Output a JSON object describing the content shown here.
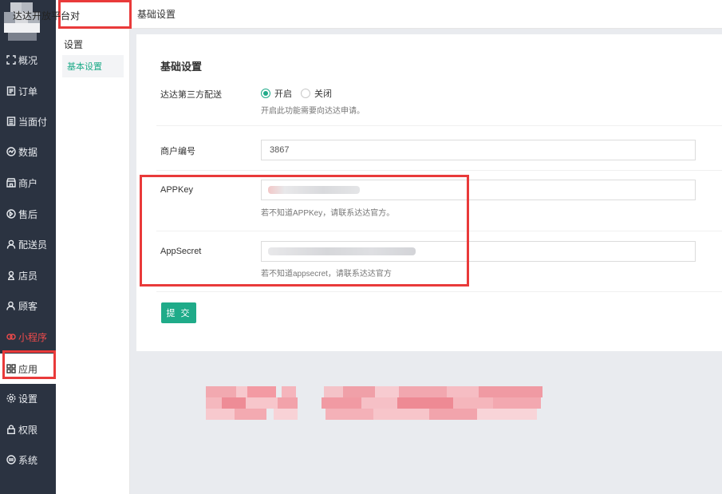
{
  "sidebar": {
    "items": [
      {
        "label": "概况",
        "icon": "overview-icon"
      },
      {
        "label": "订单",
        "icon": "order-icon"
      },
      {
        "label": "当面付",
        "icon": "pay-icon"
      },
      {
        "label": "数据",
        "icon": "chart-icon"
      },
      {
        "label": "商户",
        "icon": "shop-icon"
      },
      {
        "label": "售后",
        "icon": "aftersale-icon"
      },
      {
        "label": "配送员",
        "icon": "courier-icon"
      },
      {
        "label": "店员",
        "icon": "clerk-icon"
      },
      {
        "label": "顾客",
        "icon": "customer-icon"
      },
      {
        "label": "小程序",
        "icon": "miniprogram-icon"
      },
      {
        "label": "应用",
        "icon": "apps-icon"
      },
      {
        "label": "设置",
        "icon": "gear-icon"
      },
      {
        "label": "权限",
        "icon": "lock-icon"
      },
      {
        "label": "系统",
        "icon": "system-icon"
      }
    ]
  },
  "subnav": {
    "tab": "达达开放平台对",
    "group": "设置",
    "item": "基本设置"
  },
  "topbar": {
    "title": "基础设置"
  },
  "form": {
    "title": "基础设置",
    "delivery_label": "达达第三方配送",
    "radio_on": "开启",
    "radio_off": "关闭",
    "delivery_hint": "开启此功能需要向达达申请。",
    "merchant_label": "商户编号",
    "merchant_value": "3867",
    "appkey_label": "APPKey",
    "appkey_hint": "若不知道APPKey，请联系达达官方。",
    "appsecret_label": "AppSecret",
    "appsecret_hint": "若不知道appsecret，请联系达达官方",
    "submit": "提 交"
  },
  "colors": {
    "sidebar_bg": "#2b3341",
    "accent": "#1fab89",
    "annotation": "#e93a3a",
    "highlight": "#ee4b4b"
  }
}
